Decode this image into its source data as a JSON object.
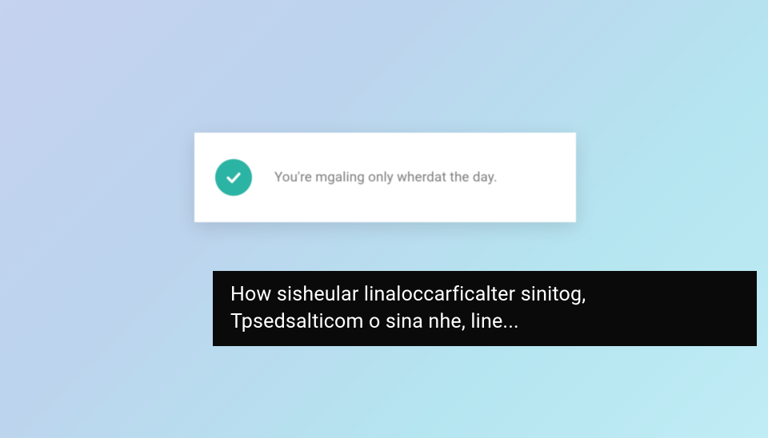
{
  "notification": {
    "message": "You're mgaling only wherdat the day.",
    "icon": "check"
  },
  "caption": {
    "text": "How sisheular linaloccarficalter sinitog,\nTpsedsalticom o sina nhe, line..."
  },
  "colors": {
    "accent": "#2bb3a3",
    "caption_bg": "#0a0a0a"
  }
}
